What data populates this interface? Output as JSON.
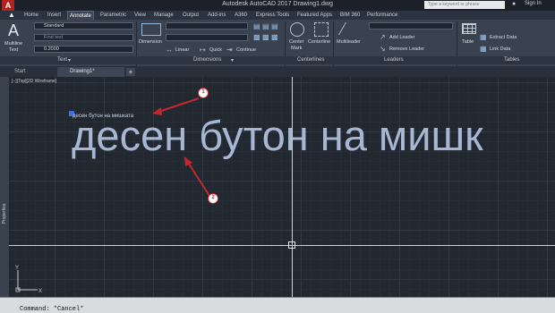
{
  "app": {
    "title": "Autodesk AutoCAD 2017   Drawing1.dwg",
    "logo_letter": "A",
    "search_placeholder": "Type a keyword or phrase",
    "signin": "Sign In",
    "brand_color": "#b2211e"
  },
  "ribbon_tabs": [
    "Home",
    "Insert",
    "Annotate",
    "Parametric",
    "View",
    "Manage",
    "Output",
    "Add-ins",
    "A360",
    "Express Tools",
    "Featured Apps",
    "BIM 360",
    "Performance"
  ],
  "active_tab": "Annotate",
  "ribbon": {
    "text_panel": {
      "big_button": "Multiline\nText",
      "style_value": "Standard",
      "find_placeholder": "Find text",
      "height_value": "0.2000",
      "label": "Text"
    },
    "dimensions_panel": {
      "dimension_button": "Dimension",
      "linear": "Linear",
      "quick": "Quick",
      "continue": "Continue",
      "label": "Dimensions"
    },
    "centerlines_panel": {
      "center_mark": "Center\nMark",
      "centerline": "Centerline",
      "label": "Centerlines"
    },
    "leaders_panel": {
      "multileader": "Multileader",
      "add_leader": "Add Leader",
      "remove_leader": "Remove Leader",
      "label": "Leaders"
    },
    "tables_panel": {
      "table": "Table",
      "extract_data": "Extract Data",
      "link_data": "Link Data",
      "label": "Tables"
    }
  },
  "doc_tabs": [
    "Start",
    "Drawing1*"
  ],
  "new_tab": "+",
  "viewport_label": "[−][Top][2D Wireframe]",
  "properties_label": "Properties",
  "drawing": {
    "small_text": "десен бутон на мишката",
    "big_text": "десен бутон на мишк"
  },
  "annotations": [
    "1",
    "2"
  ],
  "ucs": {
    "x": "X",
    "y": "Y"
  },
  "command_line": "Command: *Cancel*"
}
